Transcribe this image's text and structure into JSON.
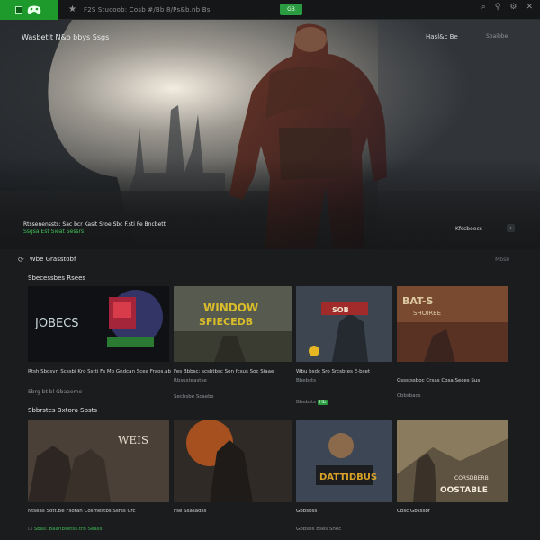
{
  "topbar": {
    "nav_text": "F2S  Stucoob: Cosb  #/Bb 8/Ps&b.nb  Bs",
    "center_badge": "GB",
    "icons": [
      "search-icon",
      "notification-icon",
      "settings-icon",
      "close-icon"
    ]
  },
  "hero": {
    "title": "Wasbetit N&o bbys Ssgs",
    "right_a": "Hasl&c Be",
    "right_b": "Sbaibbe",
    "caption_line1": "Rtssenenssts: Sac bcr Kasit Sroe Sbc F.sti Fe Bncbett",
    "caption_line2": "Ssgsa Est Sieat Sessrs",
    "right_button": "Kfssboecs"
  },
  "section_header": {
    "title": "Wbe Grasstobf",
    "more": "Mbsb"
  },
  "row1": {
    "title": "Sbecessbes Rsees",
    "cards": [
      {
        "art_text": "JOBECS",
        "caption": "Rtsh Sbosvr: Scssbi Kro Sstti Fs Mb Gndcan Scea Fraos.ab",
        "sub": "Sbrg bt bl Gbaaeme"
      },
      {
        "art_text_1": "WINDOW",
        "art_text_2": "SFIECEDB",
        "caption": "Fes Bbbsc: scsbtbsc Son fcsus Soc Siaae",
        "sub": "Rbsusteastse",
        "sub2": "Sechsbe Scaebs"
      },
      {
        "art_text": "SOB",
        "caption": "Wbu bsdc Sro Srcsbtes E-bset",
        "sub": "Bbebsts",
        "badge": "Hb"
      },
      {
        "art_text_1": "BAT-S",
        "art_text_2": "SHOIREE",
        "caption": "Gssstssboc Crsas Cosa Seces Sus",
        "sub": "Cbbsbacs"
      }
    ]
  },
  "row2": {
    "title": "Sbbrstes Bxtora Sbsts",
    "cards": [
      {
        "art_text": "WEIS",
        "caption": "Ntseas Sott.Be Fsotan Cosmestbs Ssrss Crc",
        "sub": "Sbas: Baanbsetss.trb Seass"
      },
      {
        "caption": "Fse Ssasadss"
      },
      {
        "art_text": "DATTIDBUS",
        "caption": "Gbbsbss",
        "sub": "Gbbsbs Bses Snec"
      },
      {
        "art_text_1": "CORSDBERB",
        "art_text_2": "OOSTABLE",
        "caption": "Cbsc Gbsssbr"
      }
    ]
  },
  "colors": {
    "accent": "#2a9b40",
    "background": "#1b1c1e",
    "topbar": "#151617"
  }
}
